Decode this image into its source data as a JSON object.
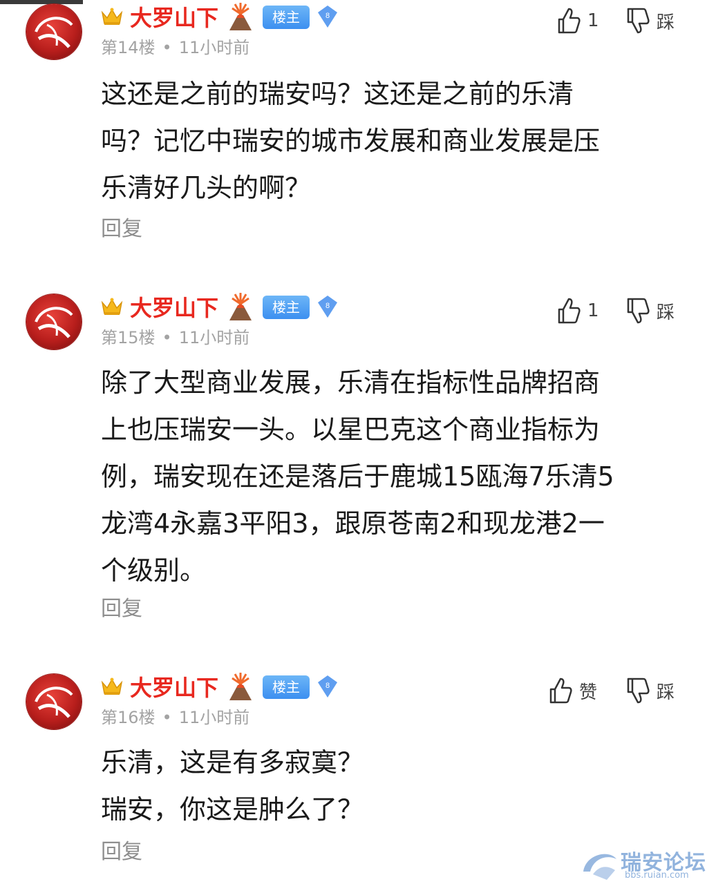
{
  "posts": [
    {
      "username": "大罗山下",
      "owner_badge": "楼主",
      "level": "8",
      "floor": "第14楼",
      "time": "11小时前",
      "like_label": "1",
      "dislike_label": "踩",
      "content": [
        "这还是之前的瑞安吗？这还是之前的乐清",
        "吗？记忆中瑞安的城市发展和商业发展是压",
        "乐清好几头的啊？"
      ],
      "reply_label": "回复"
    },
    {
      "username": "大罗山下",
      "owner_badge": "楼主",
      "level": "8",
      "floor": "第15楼",
      "time": "11小时前",
      "like_label": "1",
      "dislike_label": "踩",
      "content": [
        "除了大型商业发展，乐清在指标性品牌招商",
        "上也压瑞安一头。以星巴克这个商业指标为",
        "例，瑞安现在还是落后于鹿城15瓯海7乐清5",
        "龙湾4永嘉3平阳3，跟原苍南2和现龙港2一",
        "个级别。"
      ],
      "reply_label": "回复"
    },
    {
      "username": "大罗山下",
      "owner_badge": "楼主",
      "level": "8",
      "floor": "第16楼",
      "time": "11小时前",
      "like_label": "赞",
      "dislike_label": "踩",
      "content": [
        "乐清，这是有多寂寞？",
        "瑞安，你这是肿么了？"
      ],
      "reply_label": "回复"
    }
  ],
  "watermark": {
    "name": "瑞安论坛",
    "url": "bbs.ruian.com"
  },
  "icons": {
    "avatar": "avatar-image",
    "crown": "crown-icon",
    "volcano": "volcano-emoji-icon",
    "level": "diamond-level-icon",
    "like": "thumbs-up-icon",
    "dislike": "thumbs-down-icon"
  },
  "colors": {
    "username": "#e8281f",
    "owner_badge": "#4a9af2",
    "meta": "#a3a3a3",
    "reply": "#8e8e8e"
  }
}
